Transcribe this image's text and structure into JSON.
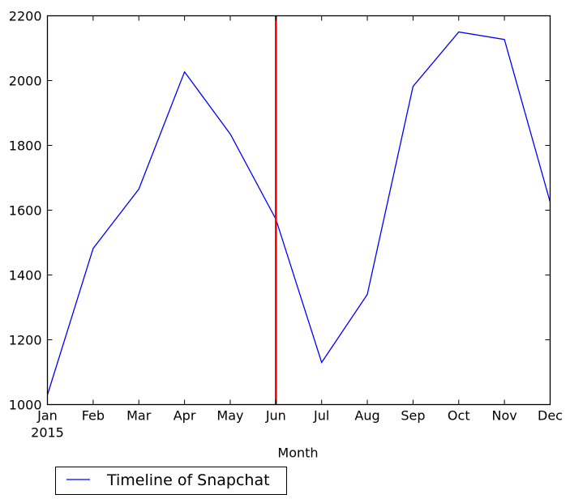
{
  "chart_data": {
    "type": "line",
    "title": "",
    "xlabel": "Month",
    "ylabel": "",
    "x": [
      "Jan",
      "Feb",
      "Mar",
      "Apr",
      "May",
      "Jun",
      "Jul",
      "Aug",
      "Sep",
      "Oct",
      "Nov",
      "Dec"
    ],
    "x_tick_labels": [
      "Jan",
      "Feb",
      "Mar",
      "Apr",
      "May",
      "Jun",
      "Jul",
      "Aug",
      "Sep",
      "Oct",
      "Nov",
      "Dec"
    ],
    "x_sub_label": "2015",
    "ylim": [
      1000,
      2200
    ],
    "y_ticks": [
      1000,
      1200,
      1400,
      1600,
      1800,
      2000,
      2200
    ],
    "grid": false,
    "series": [
      {
        "name": "Timeline of Snapchat",
        "color": "#0000ff",
        "values": [
          1030,
          1482,
          1665,
          2027,
          1835,
          1572,
          1130,
          1340,
          1982,
          2150,
          2127,
          1625
        ]
      }
    ],
    "annotations": [
      {
        "type": "vertical-line",
        "x": "Jun",
        "color": "#ff0000"
      }
    ],
    "legend": {
      "position": "bottom-left-outside",
      "entries": [
        "Timeline of Snapchat"
      ]
    }
  }
}
